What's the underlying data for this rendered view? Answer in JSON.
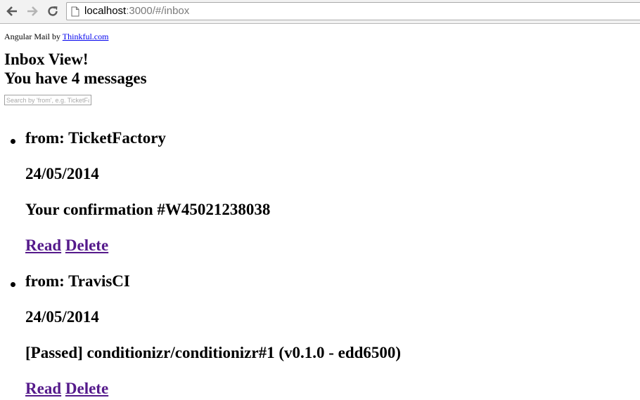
{
  "browser": {
    "url_host": "localhost",
    "url_path": ":3000/#/inbox"
  },
  "page": {
    "brand_prefix": "Angular Mail by ",
    "brand_link": "Thinkful.com",
    "title": "Inbox View!",
    "count_text": "You have 4 messages",
    "search": {
      "placeholder": "Search by 'from', e.g. TicketFactory",
      "value": ""
    }
  },
  "messages": [
    {
      "from": "from: TicketFactory",
      "date": "24/05/2014",
      "subject": "Your confirmation #W45021238038",
      "read_label": "Read",
      "delete_label": "Delete"
    },
    {
      "from": "from: TravisCI",
      "date": "24/05/2014",
      "subject": "[Passed] conditionizr/conditionizr#1 (v0.1.0 - edd6500)",
      "read_label": "Read",
      "delete_label": "Delete"
    }
  ],
  "colors": {
    "link": "#0000ee",
    "visited_link": "#551a8b"
  },
  "icons": {
    "back": "arrow-left-icon",
    "forward": "arrow-right-icon",
    "reload": "reload-icon",
    "page": "page-icon"
  }
}
